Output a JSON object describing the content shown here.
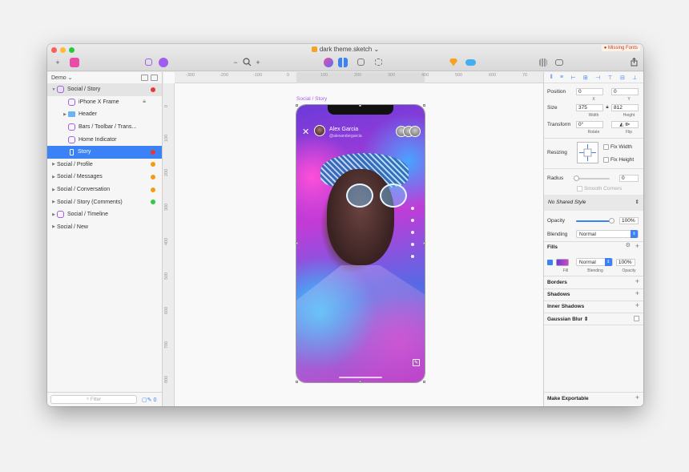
{
  "window": {
    "title": "dark theme.sketch",
    "missing_fonts": "Missing Fonts"
  },
  "toolbar": {
    "insert": "+",
    "zoom_minus": "−",
    "zoom_plus": "+"
  },
  "layers": {
    "page_name": "Demo",
    "items": [
      {
        "label": "Social / Story",
        "kind": "symbol",
        "level": 0,
        "expanded": true,
        "dot": "#e53935",
        "style": "page"
      },
      {
        "label": "iPhone X Frame",
        "kind": "symbol",
        "level": 1,
        "lock": true
      },
      {
        "label": "Header",
        "kind": "folder",
        "level": 1,
        "collapsed": true
      },
      {
        "label": "Bars / Toolbar / Trans...",
        "kind": "symbol",
        "level": 1
      },
      {
        "label": "Home Indicator",
        "kind": "symbol",
        "level": 1
      },
      {
        "label": "Story",
        "kind": "rect",
        "level": 1,
        "dot": "#e53935",
        "style": "sel"
      },
      {
        "label": "Social / Profile",
        "kind": "none",
        "level": 0,
        "collapsed": true,
        "dot": "#f39c12"
      },
      {
        "label": "Social / Messages",
        "kind": "none",
        "level": 0,
        "collapsed": true,
        "dot": "#f39c12"
      },
      {
        "label": "Social / Conversation",
        "kind": "none",
        "level": 0,
        "collapsed": true,
        "dot": "#f39c12"
      },
      {
        "label": "Social / Story (Comments)",
        "kind": "none",
        "level": 0,
        "collapsed": true,
        "dot": "#2ecc40"
      },
      {
        "label": "Social / Timeline",
        "kind": "symbol",
        "level": 0,
        "collapsed": true
      },
      {
        "label": "Social / New",
        "kind": "none",
        "level": 0,
        "collapsed": true
      }
    ],
    "filter_placeholder": "Filter",
    "filter_count": "0"
  },
  "canvas": {
    "ruler_top": [
      "-300",
      "-200",
      "-100",
      "0",
      "100",
      "200",
      "300",
      "400",
      "500",
      "600",
      "70"
    ],
    "ruler_left": [
      "0",
      "100",
      "200",
      "300",
      "400",
      "500",
      "600",
      "700",
      "800"
    ],
    "artboard_label": "Social / Story",
    "story": {
      "name": "Alex Garcia",
      "handle": "@alexandergarcia"
    }
  },
  "inspector": {
    "position_label": "Position",
    "x": "0",
    "y": "0",
    "x_cap": "X",
    "y_cap": "Y",
    "size_label": "Size",
    "width": "375",
    "height": "812",
    "width_cap": "Width",
    "height_cap": "Height",
    "transform_label": "Transform",
    "rotate": "0°",
    "rotate_cap": "Rotate",
    "flip_cap": "Flip",
    "resizing_label": "Resizing",
    "fix_width": "Fix Width",
    "fix_height": "Fix Height",
    "radius_label": "Radius",
    "radius": "0",
    "smooth_corners": "Smooth Corners",
    "shared_style": "No Shared Style",
    "opacity_label": "Opacity",
    "opacity": "100%",
    "opacity_fraction": 1.0,
    "blending_label": "Blending",
    "blending": "Normal",
    "fills_title": "Fills",
    "fill_blend": "Normal",
    "fill_opacity": "100%",
    "fill_cap": "Fill",
    "fill_blend_cap": "Blending",
    "fill_opacity_cap": "Opacity",
    "borders": "Borders",
    "shadows": "Shadows",
    "inner_shadows": "Inner Shadows",
    "gaussian_blur": "Gaussian Blur",
    "make_exportable": "Make Exportable"
  }
}
